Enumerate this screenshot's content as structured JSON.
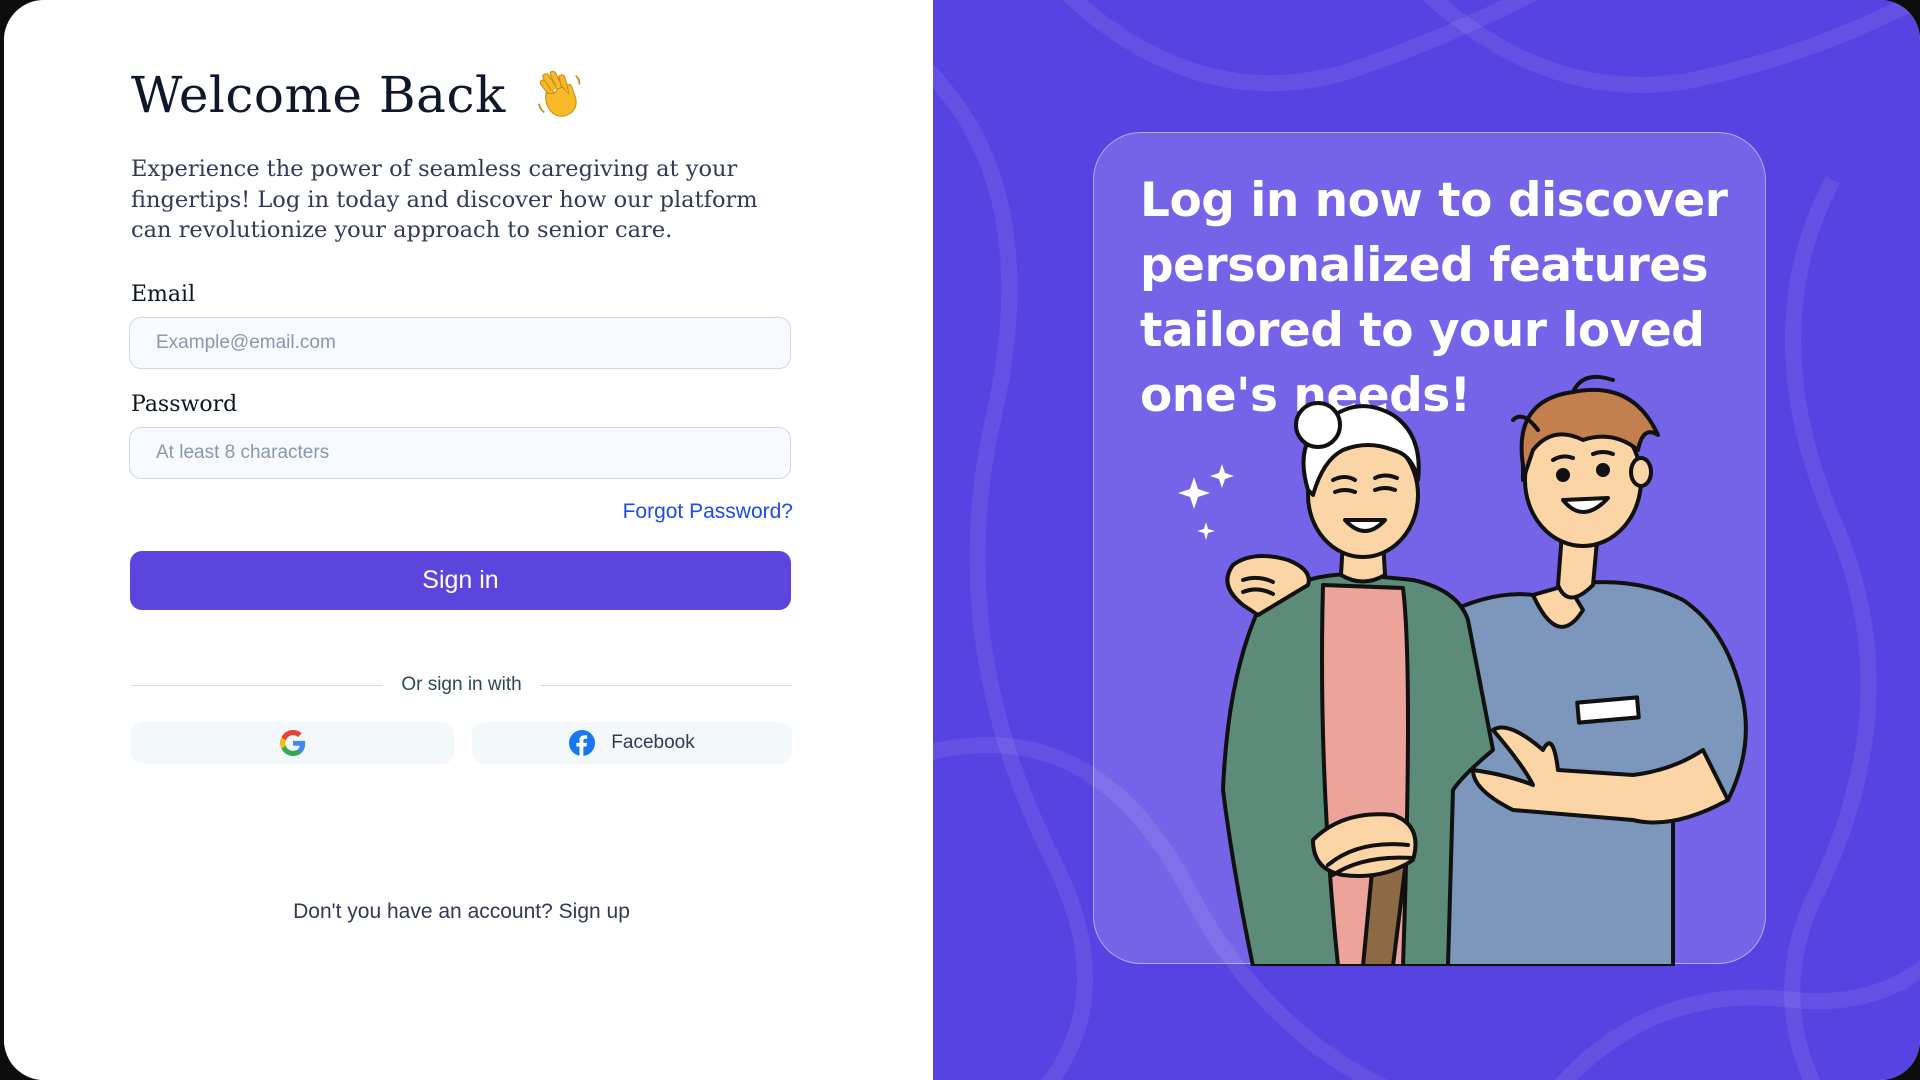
{
  "login": {
    "title": "Welcome Back",
    "wave_icon": "waving-hand-icon",
    "intro": "Experience the power of seamless caregiving at your fingertips! Log in today and discover how our platform can revolutionize your approach to senior care.",
    "email_label": "Email",
    "email_placeholder": "Example@email.com",
    "email_value": "",
    "password_label": "Password",
    "password_placeholder": "At least 8 characters",
    "password_value": "",
    "forgot_label": "Forgot Password?",
    "signin_label": "Sign in",
    "divider_text": "Or sign in with",
    "google_icon": "google-icon",
    "facebook_icon": "facebook-icon",
    "facebook_label": "Facebook",
    "signup_prompt": "Don't you have an account?",
    "signup_label": "Sign up"
  },
  "promo": {
    "headline": "Log in now to discover personalized features tailored to  your loved one's needs!",
    "illustration": "caregiver-with-elderly-woman-illustration"
  },
  "colors": {
    "accent": "#5B45DD",
    "promo_background": "#5743E2",
    "link": "#1E4AE9"
  }
}
